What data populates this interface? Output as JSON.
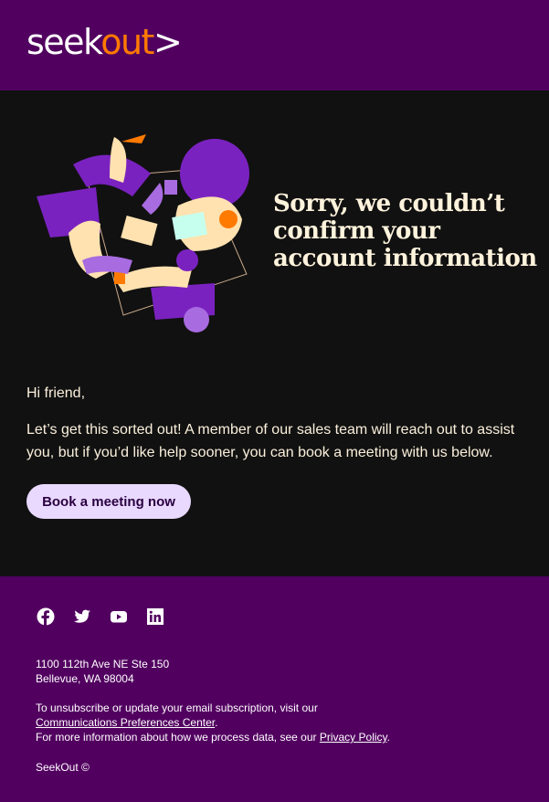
{
  "brand": {
    "logo_part1": "seek",
    "logo_part2": "out",
    "logo_chevron": ">",
    "colors": {
      "header": "#520060",
      "accent": "#ff7a00",
      "body": "#111111",
      "button": "#e9d9ff"
    }
  },
  "hero": {
    "title": "Sorry, we couldn’t confirm your account information",
    "illustration": "people-around-table-illustration"
  },
  "body": {
    "greeting": "Hi friend,",
    "message": "Let’s get this sorted out! A member of our sales team will reach out to assist you, but if you’d like help sooner, you can book a meeting with us below.",
    "button": "Book a meeting now"
  },
  "footer": {
    "social": [
      "facebook-icon",
      "twitter-icon",
      "youtube-icon",
      "linkedin-icon"
    ],
    "address_line1": "1100 112th Ave NE Ste 150",
    "address_line2": "Bellevue, WA 98004",
    "unsub_text": "To unsubscribe or update your email subscription, visit our",
    "prefs_link": "Communications Preferences Center",
    "period": ".",
    "privacy_text": "For more information about how we process data, see our",
    "privacy_link": "Privacy Policy",
    "copyright": "SeekOut ©"
  }
}
